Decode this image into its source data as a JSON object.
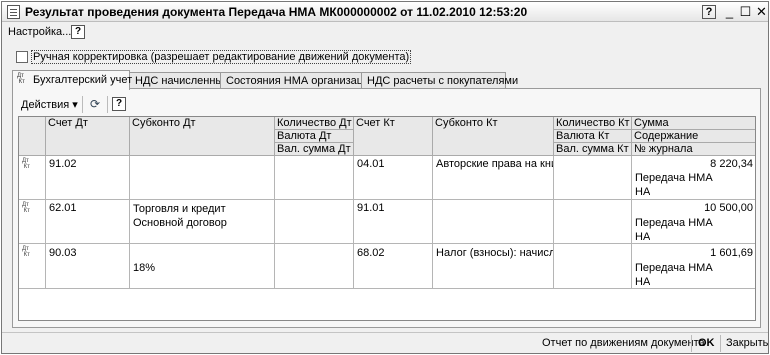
{
  "window": {
    "title": "Результат проведения документа Передача НМА МК000000002 от 11.02.2010 12:53:20",
    "help": "?",
    "minimize": "_",
    "maximize": "☐",
    "close": "✕"
  },
  "menu": {
    "settings": "Настройка...",
    "help": "?"
  },
  "manual_adjust": {
    "label": "Ручная корректировка (разрешает редактирование движений документа)",
    "checked": false
  },
  "tabs": [
    {
      "label": "Бухгалтерский учет",
      "active": true
    },
    {
      "label": "НДС начисленный",
      "active": false
    },
    {
      "label": "Состояния НМА организаций",
      "active": false
    },
    {
      "label": "НДС расчеты с покупателями",
      "active": false
    }
  ],
  "tab_icon_text": "Дт\nКт",
  "toolbar": {
    "actions": "Действия ▾",
    "help": "?"
  },
  "grid": {
    "headers": {
      "schet_dt": "Счет Дт",
      "subkonto_dt": "Субконто Дт",
      "kol_dt": "Количество Дт",
      "valuta_dt": "Валюта Дт",
      "val_summa_dt": "Вал. сумма Дт",
      "schet_kt": "Счет Кт",
      "subkonto_kt": "Субконто Кт",
      "kol_kt": "Количество Кт",
      "valuta_kt": "Валюта Кт",
      "val_summa_kt": "Вал. сумма Кт",
      "summa": "Сумма",
      "soderzhanie": "Содержание",
      "nomer_zhurnala": "№ журнала"
    },
    "rows": [
      {
        "schet_dt": "91.02",
        "subkonto_dt_1": "",
        "subkonto_dt_2": "",
        "subkonto_dt_3": "",
        "schet_kt": "04.01",
        "subkonto_kt_1": "Авторские права на книгу",
        "summa": "8 220,34",
        "soderzhanie": "Передача НМА",
        "zhurnal": "НА"
      },
      {
        "schet_dt": "62.01",
        "subkonto_dt_1": "Торговля и кредит",
        "subkonto_dt_2": "Основной договор",
        "subkonto_dt_3": "",
        "schet_kt": "91.01",
        "subkonto_kt_1": "",
        "summa": "10 500,00",
        "soderzhanie": "Передача НМА",
        "zhurnal": "НА"
      },
      {
        "schet_dt": "90.03",
        "subkonto_dt_1": "",
        "subkonto_dt_2": "18%",
        "subkonto_dt_3": "",
        "schet_kt": "68.02",
        "subkonto_kt_1": "Налог (взносы): начисле...",
        "summa": "1 601,69",
        "soderzhanie": "Передача НМА",
        "zhurnal": "НА"
      }
    ]
  },
  "footer": {
    "report": "Отчет по движениям документа",
    "ok": "OK",
    "close": "Закрыть"
  }
}
